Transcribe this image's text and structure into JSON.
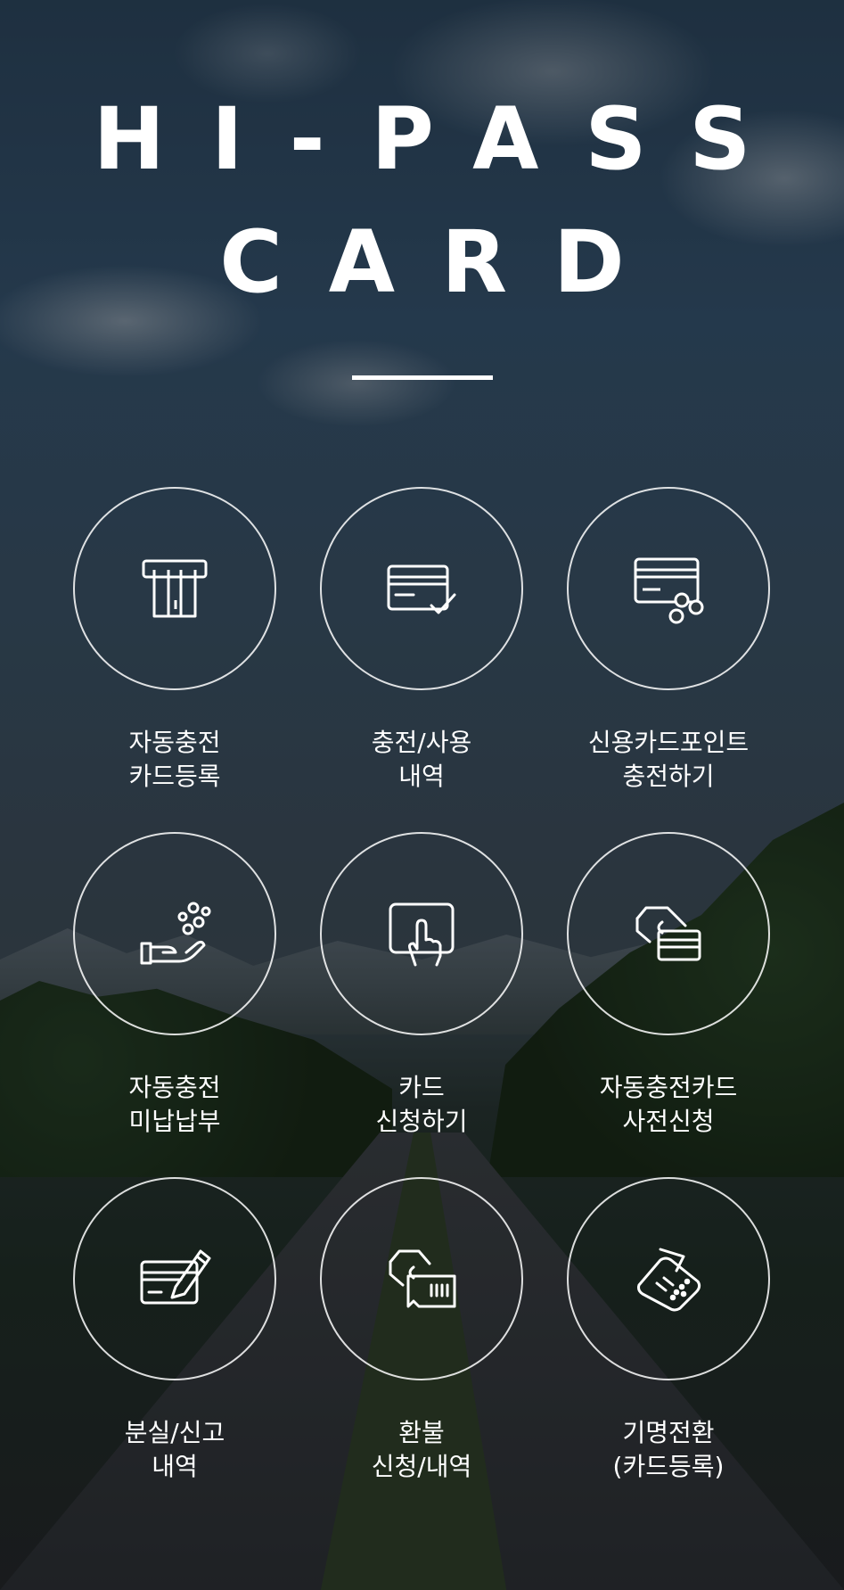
{
  "header": {
    "title_line1": "HI-PASS",
    "title_line2": "CARD"
  },
  "menu": [
    {
      "icon": "card-insert-icon",
      "line1": "자동충전",
      "line2": "카드등록"
    },
    {
      "icon": "card-check-icon",
      "line1": "충전/사용",
      "line2": "내역"
    },
    {
      "icon": "card-coins-icon",
      "line1": "신용카드포인트",
      "line2": "충전하기"
    },
    {
      "icon": "hand-coins-icon",
      "line1": "자동충전",
      "line2": "미납납부"
    },
    {
      "icon": "tap-finger-icon",
      "line1": "카드",
      "line2": "신청하기"
    },
    {
      "icon": "hand-card-icon",
      "line1": "자동충전카드",
      "line2": "사전신청"
    },
    {
      "icon": "card-pen-icon",
      "line1": "분실/신고",
      "line2": "내역"
    },
    {
      "icon": "hand-ticket-icon",
      "line1": "환불",
      "line2": "신청/내역"
    },
    {
      "icon": "card-terminal-icon",
      "line1": "기명전환",
      "line2": "(카드등록)"
    }
  ]
}
